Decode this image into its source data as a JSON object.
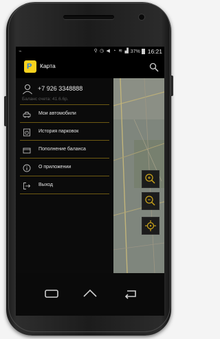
{
  "status_bar": {
    "time": "16:21",
    "battery": "37%"
  },
  "action_bar": {
    "title": "Карта"
  },
  "drawer": {
    "phone": "+7 926 3348888",
    "balance": "Баланс счета: 41.6.6р.",
    "items": [
      {
        "label": "Мои автомобили",
        "icon": "car-icon"
      },
      {
        "label": "История парковок",
        "icon": "history-icon"
      },
      {
        "label": "Пополнение баланса",
        "icon": "wallet-icon"
      },
      {
        "label": "О приложении",
        "icon": "info-icon"
      },
      {
        "label": "Выход",
        "icon": "logout-icon"
      }
    ]
  },
  "colors": {
    "accent": "#c9a21a",
    "divider": "#6e5a12",
    "logo_bg": "#f7d21e"
  }
}
